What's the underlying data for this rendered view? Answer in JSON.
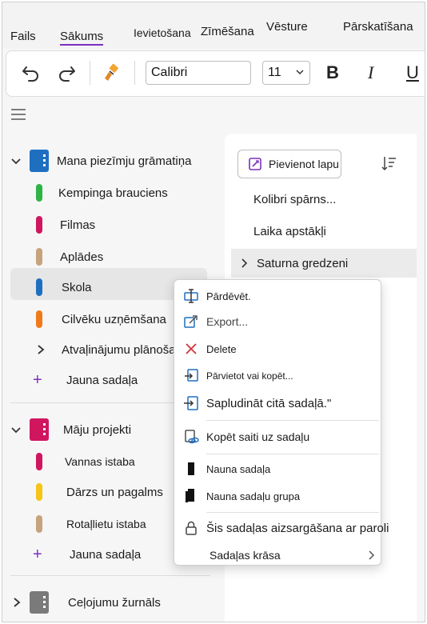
{
  "tabs": [
    {
      "label": "Fails"
    },
    {
      "label": "Sākums",
      "active": true
    },
    {
      "label": "Ievietošana"
    },
    {
      "label": "Zīmēšana"
    },
    {
      "label": "Vēsture"
    },
    {
      "label": "Pārskatīšana"
    }
  ],
  "toolbar": {
    "font_name": "Calibri",
    "font_size": "11",
    "bold_label": "B",
    "italic_label": "I",
    "underline_label": "U"
  },
  "notebooks": [
    {
      "name": "Mana piezīmju grāmatiņa",
      "color": "#1f6fc1",
      "expanded": true,
      "sections": [
        {
          "name": "Kempinga brauciens",
          "color": "#2fb344"
        },
        {
          "name": "Filmas",
          "color": "#d0165f"
        },
        {
          "name": "Aplādes",
          "color": "#c7a27c"
        },
        {
          "name": "Skola",
          "color": "#1f6fc1",
          "selected": true
        },
        {
          "name": "Cilvēku uzņēmšana",
          "color": "#f07a1a"
        },
        {
          "name": "Atvaļinājumu plānošana",
          "group": true
        }
      ],
      "new_section_label": "Jauna sadaļa"
    },
    {
      "name": "Māju projekti",
      "color": "#d0165f",
      "expanded": true,
      "sections": [
        {
          "name": "Vannas istaba",
          "color": "#d0165f"
        },
        {
          "name": "Dārzs un pagalms",
          "color": "#f5c518"
        },
        {
          "name": "Rotaļlietu istaba",
          "color": "#c7a27c"
        }
      ],
      "new_section_label": "Jauna sadaļa"
    },
    {
      "name": "Ceļojumu žurnāls",
      "color": "#7a7a7a",
      "expanded": false
    }
  ],
  "pages": {
    "add_label": "Pievienot lapu",
    "items": [
      {
        "title": "Kolibri spārns..."
      },
      {
        "title": "Laika apstākļi"
      },
      {
        "title": "Saturna gredzeni",
        "selected": true,
        "collapsible": true
      }
    ]
  },
  "context_menu": {
    "items": [
      {
        "label": "Pārdēvēt.",
        "icon": "rename-icon"
      },
      {
        "label": "Export...",
        "icon": "export-icon"
      },
      {
        "label": "Delete",
        "icon": "delete-icon"
      },
      {
        "label": "Pārvietot vai kopēt...",
        "icon": "move-copy-icon"
      },
      {
        "label": "Sapludināt citā sadaļā.\"",
        "icon": "merge-icon"
      },
      {
        "label": "Kopēt saiti uz sadaļu",
        "icon": "copy-link-icon"
      },
      {
        "label": "Nauna sadaļa",
        "icon": "new-section-icon"
      },
      {
        "label": "Nauna sadaļu grupa",
        "icon": "new-section-group-icon"
      },
      {
        "label": "Šis sadaļas aizsargāšana ar paroli",
        "icon": "lock-icon"
      },
      {
        "label": "Sadaļas krāsa",
        "icon": "color-icon"
      }
    ]
  },
  "colors": {
    "accent": "#7b2fbf",
    "delete_red": "#d13438"
  }
}
